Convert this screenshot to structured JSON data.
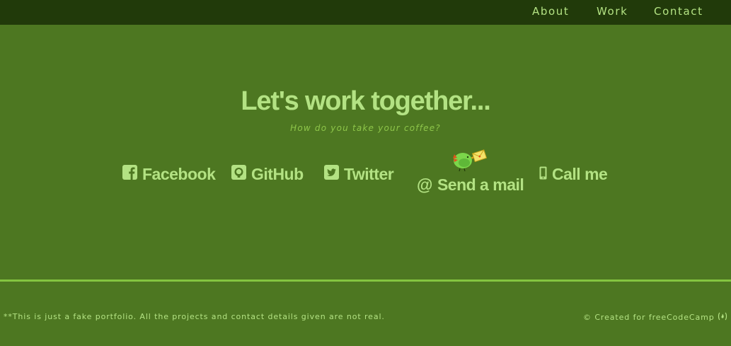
{
  "nav": {
    "items": [
      {
        "label": "About"
      },
      {
        "label": "Work"
      },
      {
        "label": "Contact"
      }
    ]
  },
  "contact": {
    "heading": "Let's work together...",
    "subheading": "How do you take your coffee?",
    "links": {
      "facebook": {
        "label": "Facebook",
        "icon": "facebook-square-icon"
      },
      "github": {
        "label": "GitHub",
        "icon": "github-square-icon"
      },
      "twitter": {
        "label": "Twitter",
        "icon": "twitter-square-icon"
      },
      "mail": {
        "label": "Send a mail",
        "icon": "at-icon",
        "decoration": "bird-with-envelope-icon"
      },
      "call": {
        "label": "Call me",
        "icon": "mobile-phone-icon"
      }
    }
  },
  "footer": {
    "disclaimer": "**This is just a fake portfolio. All the projects and contact details given are not real.",
    "credit_prefix": "© Created for",
    "credit_link": "freeCodeCamp",
    "credit_icon": "free-code-camp-icon"
  },
  "colors": {
    "background": "#4d7721",
    "navbar": "#213a0a",
    "text": "#b3e283",
    "subtext": "#8ec64a",
    "footer_line": "#84c440"
  }
}
